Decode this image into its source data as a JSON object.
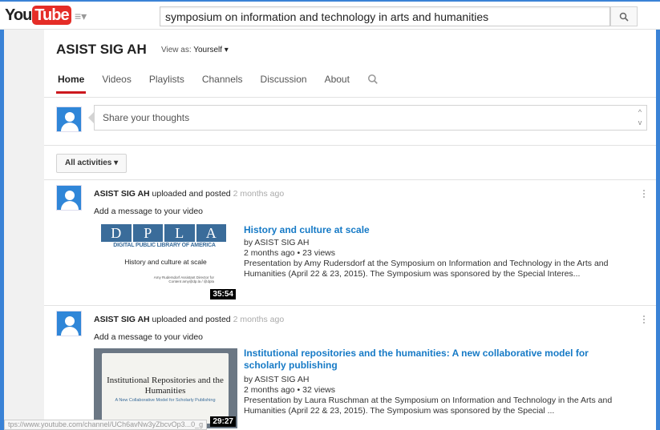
{
  "masthead": {
    "logo_you": "You",
    "logo_tube": "Tube",
    "guide_label": "≡▾",
    "search_query": "symposium on information and technology in arts and humanities",
    "search_icon": "search-icon"
  },
  "channel": {
    "title": "ASIST SIG AH",
    "view_as_label": "View as:",
    "view_as_value": "Yourself ▾",
    "tabs": [
      {
        "label": "Home",
        "active": true
      },
      {
        "label": "Videos"
      },
      {
        "label": "Playlists"
      },
      {
        "label": "Channels"
      },
      {
        "label": "Discussion"
      },
      {
        "label": "About"
      }
    ]
  },
  "share": {
    "placeholder": "Share your thoughts",
    "scroll_up": "^",
    "scroll_down": "v"
  },
  "filter": {
    "label": "All activities ▾"
  },
  "feed": [
    {
      "author": "ASIST SIG AH",
      "action": "uploaded and posted",
      "ago": "2 months ago",
      "message": "Add a message to your video",
      "title": "History and culture at scale",
      "by": "by ASIST SIG AH",
      "meta": "2 months ago • 23 views",
      "desc": "Presentation by Amy Rudersdorf at the Symposium on Information and Technology in the Arts and Humanities (April 22 & 23, 2015). The Symposium was sponsored by the Special Interes...",
      "duration": "35:54",
      "thumb": {
        "letters": [
          "D",
          "P",
          "L",
          "A"
        ],
        "sub": "DIGITAL PUBLIC LIBRARY OF AMERICA",
        "title": "History and culture at scale",
        "small": "Amy Rudersdorf Assistant Director for Content amy@dp.la / @dpla"
      }
    },
    {
      "author": "ASIST SIG AH",
      "action": "uploaded and posted",
      "ago": "2 months ago",
      "message": "Add a message to your video",
      "title": "Institutional repositories and the humanities: A new collaborative model for scholarly publishing",
      "by": "by ASIST SIG AH",
      "meta": "2 months ago • 32 views",
      "desc": "Presentation by Laura Ruschman at the Symposium on Information and Technology in the Arts and Humanities (April 22 & 23, 2015). The Symposium was sponsored by the Special    ...",
      "duration": "29:27",
      "thumb": {
        "t1": "Institutional Repositories and the Humanities",
        "t2": "A New Collaborative Model for Scholarly Publishing"
      }
    }
  ],
  "status_url": "tps://www.youtube.com/channel/UCh6avNw3yZbcvOp3...0_g"
}
